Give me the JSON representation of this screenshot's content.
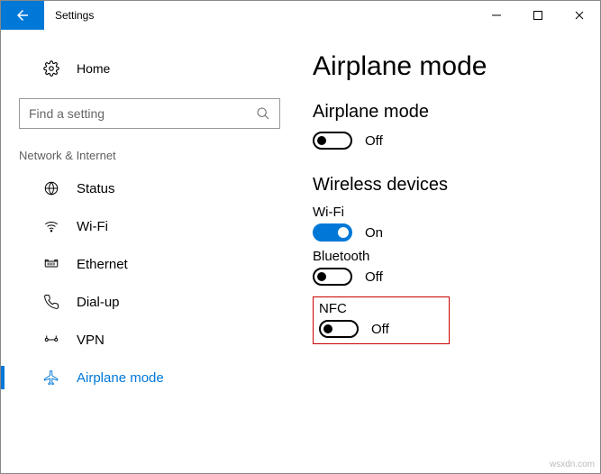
{
  "window": {
    "title": "Settings"
  },
  "home_label": "Home",
  "search": {
    "placeholder": "Find a setting"
  },
  "group_label": "Network & Internet",
  "nav": {
    "status": "Status",
    "wifi": "Wi-Fi",
    "ethernet": "Ethernet",
    "dialup": "Dial-up",
    "vpn": "VPN",
    "airplane": "Airplane mode"
  },
  "page": {
    "heading": "Airplane mode",
    "airplane_section": "Airplane mode",
    "airplane_state": "Off",
    "wireless_section": "Wireless devices",
    "wifi_label": "Wi-Fi",
    "wifi_state": "On",
    "bt_label": "Bluetooth",
    "bt_state": "Off",
    "nfc_label": "NFC",
    "nfc_state": "Off"
  },
  "watermark": "wsxdn.com"
}
